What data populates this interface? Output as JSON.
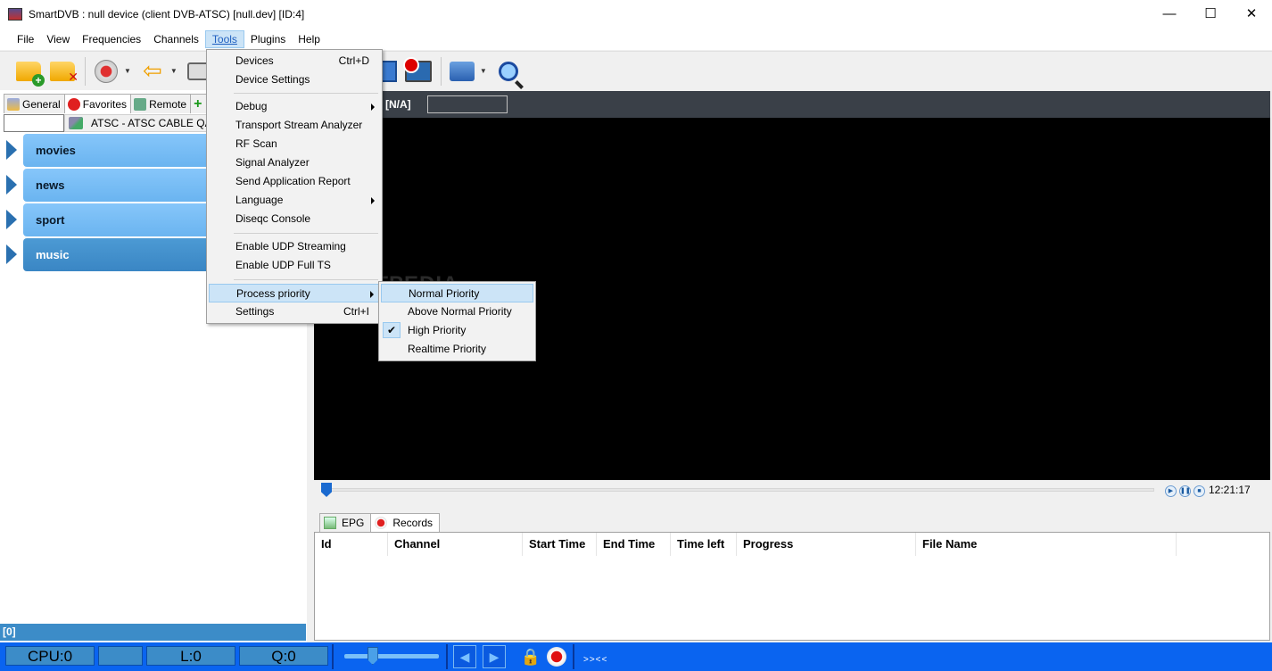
{
  "window": {
    "title": "SmartDVB : null device (client DVB-ATSC) [null.dev]  [ID:4]",
    "minimize": "—",
    "maximize": "☐",
    "close": "✕"
  },
  "menubar": {
    "items": [
      "File",
      "View",
      "Frequencies",
      "Channels",
      "Tools",
      "Plugins",
      "Help"
    ],
    "active": "Tools"
  },
  "toolbar": {
    "icons": [
      "open-folder-icon",
      "close-folder-icon",
      "record-icon",
      "back-arrow-icon",
      "camera-icon",
      "window-icon",
      "tv-record-icon",
      "print-icon",
      "search-icon"
    ]
  },
  "left_panel": {
    "tabs": [
      "General",
      "Favorites",
      "Remote",
      "+"
    ],
    "selected_tab": "Favorites",
    "source": "ATSC - ATSC CABLE QAM",
    "groups": [
      "movies",
      "news",
      "sport",
      "music"
    ],
    "selected_group": "music",
    "status": "[0]"
  },
  "video": {
    "header_label": "[N/A]",
    "watermark": "SOFTPEDIA",
    "time": "12:21:17"
  },
  "bottom_tabs": [
    "EPG",
    "Records"
  ],
  "records_table": {
    "columns": [
      "Id",
      "Channel",
      "Start Time",
      "End Time",
      "Time left",
      "Progress",
      "File Name"
    ],
    "rows": []
  },
  "statusbar": {
    "cpu": "CPU:0",
    "level": "",
    "l": "L:0",
    "q": "Q:0",
    "arrows": ">><<",
    "volume_fraction": 0.3
  },
  "tools_menu": {
    "items": [
      {
        "label": "Devices",
        "shortcut": "Ctrl+D"
      },
      {
        "label": "Device Settings"
      },
      {
        "label": "Debug",
        "submenu": true
      },
      {
        "label": "Transport Stream Analyzer"
      },
      {
        "label": "RF Scan"
      },
      {
        "label": "Signal Analyzer"
      },
      {
        "label": "Send Application Report"
      },
      {
        "label": "Language",
        "submenu": true
      },
      {
        "label": "Diseqc Console"
      },
      {
        "label": "Enable UDP Streaming"
      },
      {
        "label": "Enable UDP Full TS"
      },
      {
        "label": "Process priority",
        "submenu": true
      },
      {
        "label": "Settings",
        "shortcut": "Ctrl+I"
      }
    ]
  },
  "priority_submenu": {
    "items": [
      "Normal Priority",
      "Above Normal Priority",
      "High Priority",
      "Realtime Priority"
    ],
    "checked": "High Priority",
    "highlighted": "Normal Priority"
  }
}
